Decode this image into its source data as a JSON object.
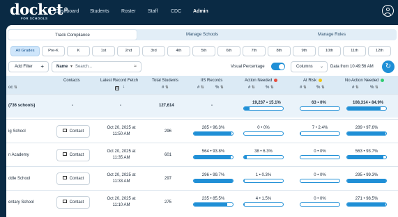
{
  "app": {
    "logo": "docket",
    "logo_tm": "®",
    "logo_sub": "FOR SCHOOLS"
  },
  "nav": {
    "items": [
      "Dashboard",
      "Students",
      "Roster",
      "Staff",
      "CDC",
      "Admin"
    ],
    "active": "Admin"
  },
  "tabs": [
    "Track Compliance",
    "Manage Schools",
    "Manage Roles"
  ],
  "active_tab": "Track Compliance",
  "grades": [
    "All Grades",
    "Pre-K",
    "K",
    "1st",
    "2nd",
    "3rd",
    "4th",
    "5th",
    "6th",
    "7th",
    "8th",
    "9th",
    "10th",
    "11th",
    "12th"
  ],
  "active_grade": "All Grades",
  "toolbar": {
    "add_filter": "Add Filter",
    "search_field": "Name",
    "search_placeholder": "Search...",
    "visual_percentage_label": "Visual Percentage",
    "visual_percentage_on": true,
    "columns_label": "Columns",
    "data_from": "Data from 10:49:56 AM"
  },
  "headers": {
    "name_suffix": "oc",
    "contacts": "Contacts",
    "latest_fetch": "Latest Record Fetch",
    "total_students": "Total Students",
    "iis_records": "IIS Records",
    "action_needed": "Action Needed",
    "at_risk": "At Risk",
    "no_action": "No Action Needed",
    "count": "#",
    "percent": "%"
  },
  "status_colors": {
    "action_needed": "#e74c3c",
    "at_risk": "#f1c40f",
    "no_action": "#2ecc71",
    "bar": "#1f8fd6"
  },
  "summary": {
    "name": "(736 schools)",
    "contacts": "-",
    "fetch": "-",
    "students": "127,614",
    "iis": "-",
    "action": "19,237 • 15.1%",
    "action_pct": 15.1,
    "atrisk": "63 • 0%",
    "atrisk_pct": 0,
    "noaction": "108,314 • 84.9%",
    "noaction_pct": 84.9
  },
  "rows": [
    {
      "name": "ig School",
      "contact": "Contact",
      "fetch_date": "Oct 20, 2025 at",
      "fetch_time": "11:50 AM",
      "students": "296",
      "iis": "285 • 96.3%",
      "iis_pct": 96.3,
      "action": "0 • 0%",
      "action_pct": 0,
      "atrisk": "7 • 2.4%",
      "atrisk_pct": 2.4,
      "noaction": "289 • 97.6%",
      "noaction_pct": 97.6
    },
    {
      "name": "n Academy",
      "contact": "Contact",
      "fetch_date": "Oct 20, 2025 at",
      "fetch_time": "11:35 AM",
      "students": "601",
      "iis": "564 • 93.8%",
      "iis_pct": 93.8,
      "action": "38 • 6.3%",
      "action_pct": 6.3,
      "atrisk": "0 • 0%",
      "atrisk_pct": 0,
      "noaction": "563 • 93.7%",
      "noaction_pct": 93.7
    },
    {
      "name": "ddle School",
      "contact": "Contact",
      "fetch_date": "Oct 20, 2025 at",
      "fetch_time": "11:33 AM",
      "students": "297",
      "iis": "296 • 99.7%",
      "iis_pct": 99.7,
      "action": "1 • 0.3%",
      "action_pct": 0.3,
      "atrisk": "0 • 0%",
      "atrisk_pct": 0,
      "noaction": "295 • 99.3%",
      "noaction_pct": 99.3
    },
    {
      "name": "entary School",
      "contact": "Contact",
      "fetch_date": "Oct 20, 2025 at",
      "fetch_time": "11:10 AM",
      "students": "275",
      "iis": "235 • 85.5%",
      "iis_pct": 85.5,
      "action": "4 • 1.5%",
      "action_pct": 1.5,
      "atrisk": "0 • 0%",
      "atrisk_pct": 0,
      "noaction": "271 • 98.5%",
      "noaction_pct": 98.5
    }
  ]
}
